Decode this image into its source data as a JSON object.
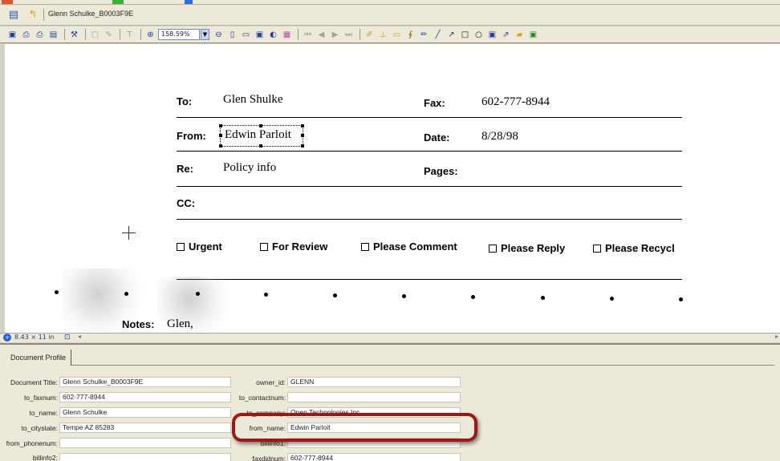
{
  "pathbar": {
    "document_title": "Glenn Schulke_B0003F9E"
  },
  "toolbar": {
    "zoom_value": "158.59%"
  },
  "fax": {
    "to_label": "To:",
    "to_value": "Glen Shulke",
    "fax_label": "Fax:",
    "fax_value": "602-777-8944",
    "from_label": "From:",
    "from_value": "Edwin Parloit",
    "date_label": "Date:",
    "date_value": "8/28/98",
    "re_label": "Re:",
    "re_value": "Policy info",
    "pages_label": "Pages:",
    "cc_label": "CC:",
    "checkboxes": [
      "Urgent",
      "For Review",
      "Please Comment",
      "Please Reply",
      "Please Recycl"
    ],
    "notes_label": "Notes:",
    "notes_value": "Glen,"
  },
  "statusbar": {
    "page_size": "8.43 × 11 in"
  },
  "profile": {
    "tab_label": "Document Profile",
    "fields_left": [
      {
        "label": "Document Title:",
        "value": "Glenn Schulke_B0003F9E"
      },
      {
        "label": "to_faxnum:",
        "value": "602-777-8944"
      },
      {
        "label": "to_name:",
        "value": "Glenn Schulke"
      },
      {
        "label": "to_citystate:",
        "value": "Tempe AZ 85283"
      },
      {
        "label": "from_phonenum:",
        "value": ""
      },
      {
        "label": "billinfo2:",
        "value": ""
      }
    ],
    "fields_right": [
      {
        "label": "owner_id:",
        "value": "GLENN"
      },
      {
        "label": "to_contactnum:",
        "value": ""
      },
      {
        "label": "to_company:",
        "value": "Open Technologies Inc"
      },
      {
        "label": "from_name:",
        "value": "Edwin Parloit"
      },
      {
        "label": "billinfo1:",
        "value": ""
      },
      {
        "label": "faxdidnum:",
        "value": "602-777-8944"
      }
    ]
  }
}
